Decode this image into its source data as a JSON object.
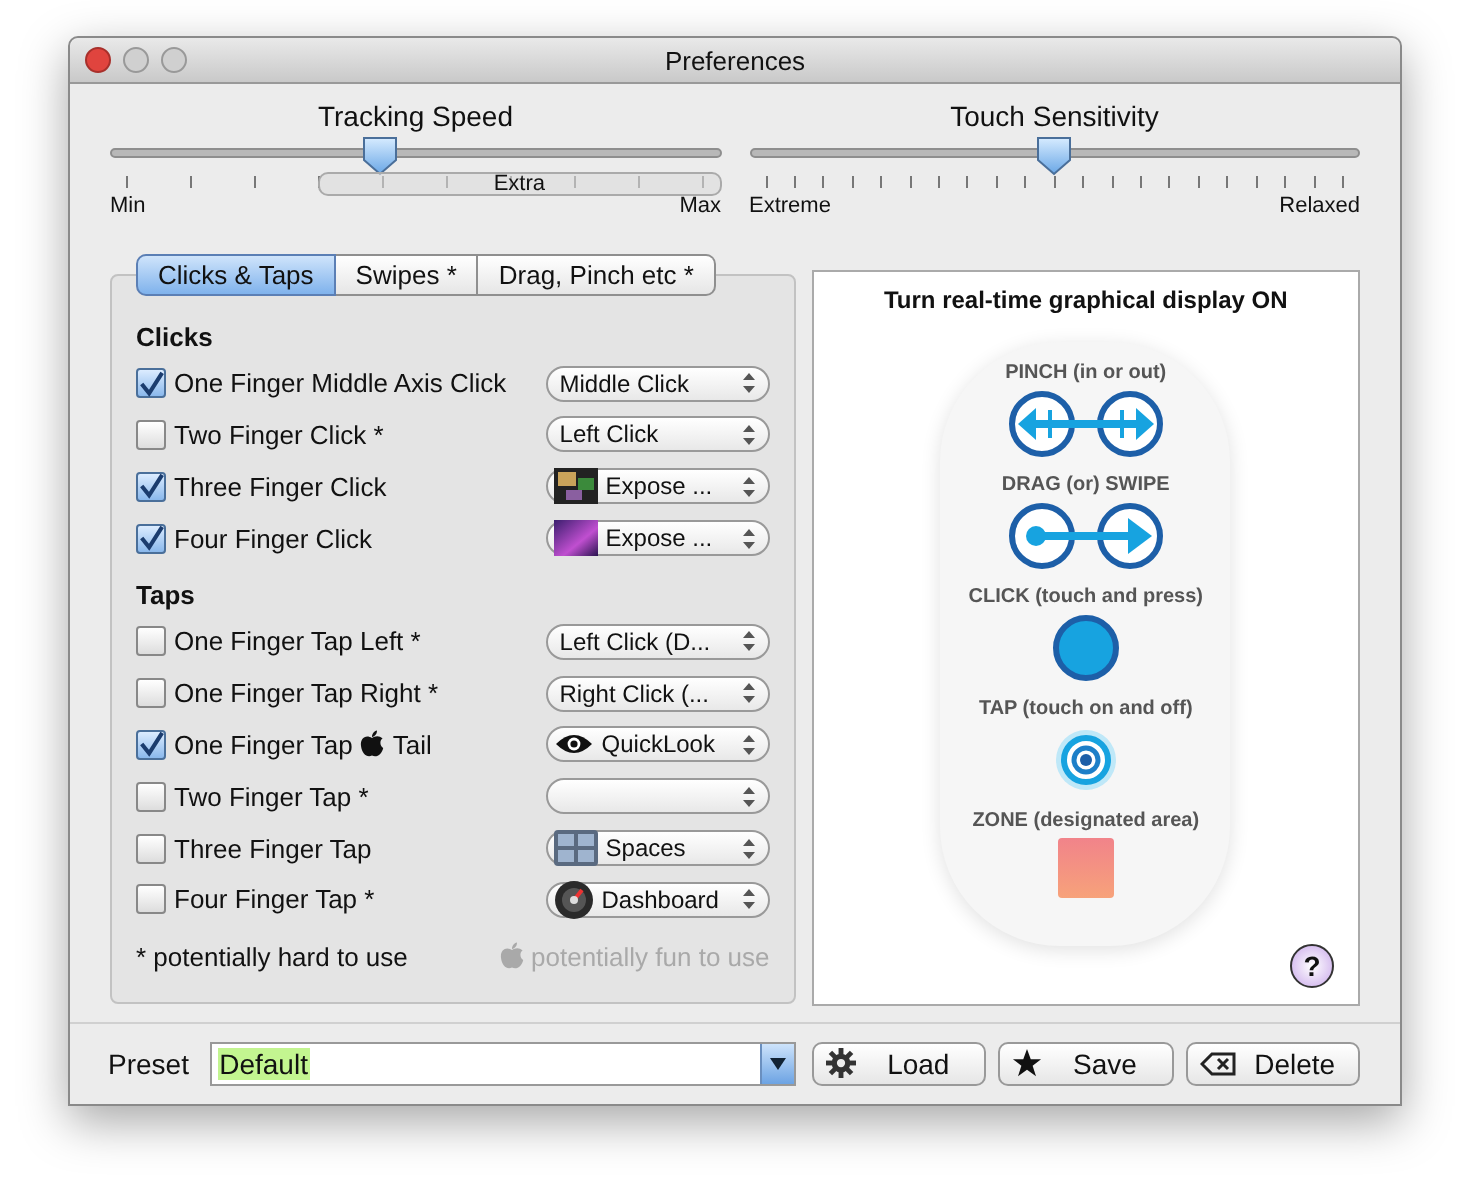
{
  "window": {
    "title": "Preferences"
  },
  "sliders": [
    {
      "title": "Tracking Speed",
      "level": 0.44,
      "min_label": "Min",
      "max_label": "Max",
      "range_label": "Extra"
    },
    {
      "title": "Touch Sensitivity",
      "level": 0.5,
      "min_label": "Extreme",
      "max_label": "Relaxed"
    }
  ],
  "tabs": [
    {
      "label": "Clicks & Taps",
      "selected": true
    },
    {
      "label": "Swipes *",
      "selected": false
    },
    {
      "label": "Drag, Pinch etc *",
      "selected": false
    }
  ],
  "sections": [
    {
      "title": "Clicks",
      "rows": [
        {
          "label": "One Finger Middle Axis Click",
          "checked": true,
          "choice": "Middle Click",
          "kind": "plain"
        },
        {
          "label": "Two Finger Click *",
          "checked": false,
          "choice": "Left Click",
          "kind": "plain"
        },
        {
          "label": "Three Finger Click",
          "checked": true,
          "choice": "Expose ...",
          "kind": "windows"
        },
        {
          "label": "Four Finger Click",
          "checked": true,
          "choice": "Expose ...",
          "kind": "desktop"
        }
      ]
    },
    {
      "title": "Taps",
      "rows": [
        {
          "label": "One Finger Tap Left *",
          "checked": false,
          "choice": "Left Click (D...",
          "kind": "plain"
        },
        {
          "label": "One Finger Tap Right *",
          "checked": false,
          "choice": "Right Click (...",
          "kind": "plain"
        },
        {
          "label": "One Finger Tap",
          "label_after_apple": "Tail",
          "checked": true,
          "choice": "QuickLook",
          "kind": "eye"
        },
        {
          "label": "Two Finger Tap *",
          "checked": false,
          "kind": "plain"
        },
        {
          "label": "Three Finger Tap",
          "checked": false,
          "choice": "Spaces",
          "kind": "grid"
        },
        {
          "label": "Four Finger Tap *",
          "checked": false,
          "choice": "Dashboard",
          "kind": "gauge"
        }
      ]
    }
  ],
  "footnotes": {
    "hard": "* potentially hard to use",
    "fun": "potentially fun to use"
  },
  "display": {
    "title": "Turn real-time graphical display ON",
    "legend": [
      {
        "kind": "pinch",
        "label": "PINCH (in or out)"
      },
      {
        "kind": "drag",
        "label": "DRAG (or) SWIPE"
      },
      {
        "kind": "click",
        "label": "CLICK (touch and press)"
      },
      {
        "kind": "tap",
        "label": "TAP (touch on and off)"
      },
      {
        "kind": "zone",
        "label": "ZONE (designated area)"
      }
    ],
    "help": "?"
  },
  "preset": {
    "label": "Preset",
    "value": "Default"
  },
  "buttons": [
    {
      "kind": "gear",
      "label": "Load"
    },
    {
      "kind": "star",
      "label": "Save"
    },
    {
      "kind": "delete",
      "label": "Delete"
    }
  ]
}
